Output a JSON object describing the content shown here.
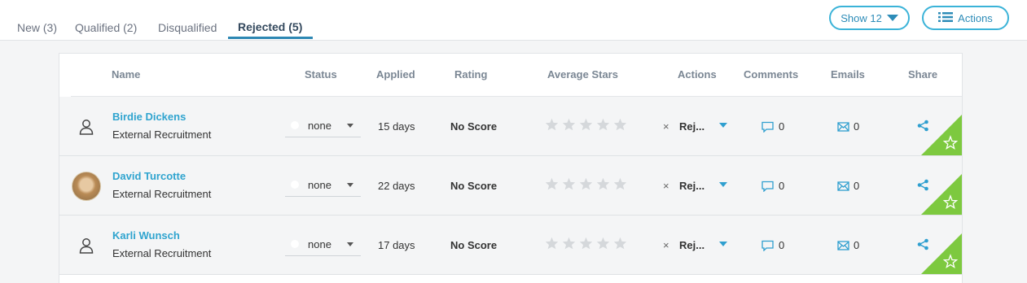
{
  "tabs": [
    {
      "label": "New (3)"
    },
    {
      "label": "Qualified (2)"
    },
    {
      "label": "Disqualified"
    },
    {
      "label": "Rejected (5)"
    }
  ],
  "toolbar": {
    "show_label": "Show 12",
    "actions_label": "Actions"
  },
  "columns": [
    "Name",
    "Status",
    "Applied",
    "Rating",
    "Average Stars",
    "Actions",
    "Comments",
    "Emails",
    "Share"
  ],
  "rows": [
    {
      "name": "Birdie Dickens",
      "source": "External Recruitment",
      "avatar": "user-icon",
      "status": "none",
      "applied": "15 days",
      "rating": "No Score",
      "average_stars": 0,
      "action_label": "Rej...",
      "comments": "0",
      "emails": "0"
    },
    {
      "name": "David Turcotte",
      "source": "External Recruitment",
      "avatar": "photo",
      "status": "none",
      "applied": "22 days",
      "rating": "No Score",
      "average_stars": 0,
      "action_label": "Rej...",
      "comments": "0",
      "emails": "0"
    },
    {
      "name": "Karli Wunsch",
      "source": "External Recruitment",
      "avatar": "user-icon",
      "status": "none",
      "applied": "17 days",
      "rating": "No Score",
      "average_stars": 0,
      "action_label": "Rej...",
      "comments": "0",
      "emails": "0"
    }
  ],
  "colors": {
    "accent": "#2fa4cf",
    "tab_underline": "#2d87b3",
    "favorite_corner": "#7dc93f",
    "star_empty": "#d5d8db"
  }
}
